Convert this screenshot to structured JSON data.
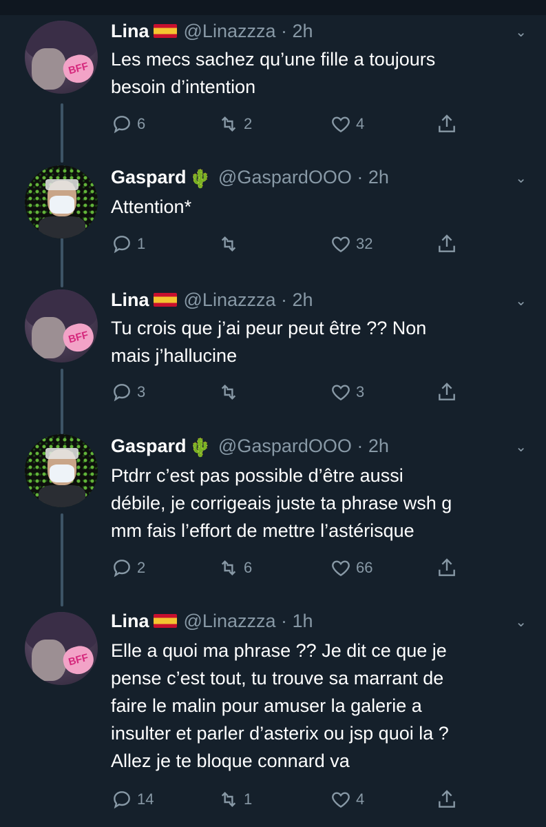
{
  "tweets": [
    {
      "name": "Lina",
      "flag": "spain-flag",
      "handle": "@Linazzza · 2h",
      "text_lines": [
        "Les mecs sachez qu’une fille a toujours",
        "besoin d’intention"
      ],
      "replies": "6",
      "retweets": "2",
      "likes": "4"
    },
    {
      "name": "Gaspard",
      "flag": "cactus",
      "handle": "@GaspardOOO · 2h",
      "text_lines": [
        "Attention*"
      ],
      "replies": "1",
      "retweets": "",
      "likes": "32"
    },
    {
      "name": "Lina",
      "flag": "spain-flag",
      "handle": "@Linazzza · 2h",
      "text_lines": [
        "Tu crois que j’ai peur peut être ?? Non",
        "mais j’hallucine"
      ],
      "replies": "3",
      "retweets": "",
      "likes": "3"
    },
    {
      "name": "Gaspard",
      "flag": "cactus",
      "handle": "@GaspardOOO · 2h",
      "text_lines": [
        "Ptdrr c’est pas possible d’être aussi",
        "débile, je corrigeais juste ta phrase wsh g",
        "mm fais l’effort de mettre l’astérisque"
      ],
      "replies": "2",
      "retweets": "6",
      "likes": "66"
    },
    {
      "name": "Lina",
      "flag": "spain-flag",
      "handle": "@Linazzza · 1h",
      "text_lines": [
        "Elle a quoi ma phrase ?? Je dit ce que je",
        "pense c’est tout, tu trouve sa marrant de",
        "faire le malin pour amuser la galerie a",
        "insulter et parler d’asterix ou jsp quoi la ?",
        "Allez je te bloque connard va"
      ],
      "replies": "14",
      "retweets": "1",
      "likes": "4"
    }
  ],
  "avatar_badge": "BFF",
  "colors": {
    "background": "#15202b",
    "secondary_text": "#8899a6",
    "thread_line": "#3d5466"
  }
}
